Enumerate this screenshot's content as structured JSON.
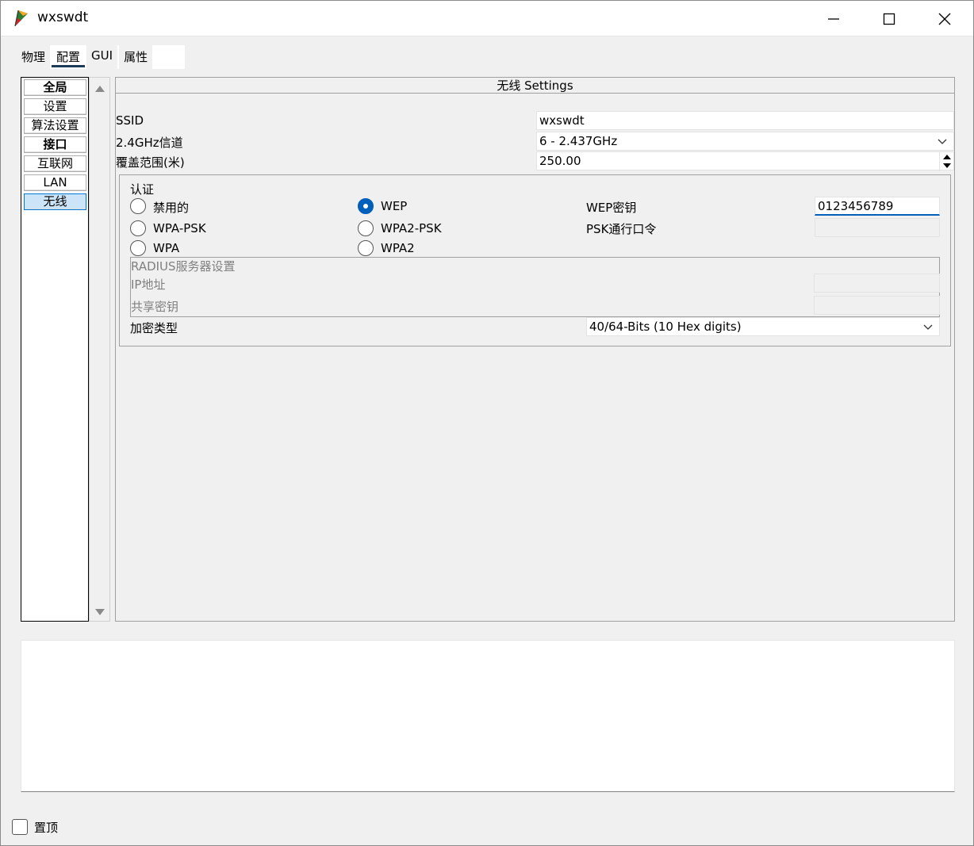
{
  "window": {
    "title": "wxswdt"
  },
  "tabs": [
    {
      "label": "物理"
    },
    {
      "label": "配置"
    },
    {
      "label": "GUI"
    },
    {
      "label": "属性"
    }
  ],
  "nav": {
    "items": [
      {
        "label": "全局"
      },
      {
        "label": "设置"
      },
      {
        "label": "算法设置"
      },
      {
        "label": "接口"
      },
      {
        "label": "互联网"
      },
      {
        "label": "LAN"
      },
      {
        "label": "无线"
      }
    ]
  },
  "panel": {
    "title": "无线 Settings",
    "ssid_label": "SSID",
    "ssid_value": "wxswdt",
    "channel_label": "2.4GHz信道",
    "channel_value": "6 - 2.437GHz",
    "range_label": "覆盖范围(米)",
    "range_value": "250.00",
    "auth": {
      "title": "认证",
      "options": [
        {
          "label": "禁用的",
          "checked": false
        },
        {
          "label": "WEP",
          "checked": true
        },
        {
          "label": "WPA-PSK",
          "checked": false
        },
        {
          "label": "WPA2-PSK",
          "checked": false
        },
        {
          "label": "WPA",
          "checked": false
        },
        {
          "label": "WPA2",
          "checked": false
        }
      ],
      "wep_key_label": "WEP密钥",
      "wep_key_value": "0123456789",
      "psk_label": "PSK通行口令",
      "radius_title": "RADIUS服务器设置",
      "ip_label": "IP地址",
      "secret_label": "共享密钥",
      "encrypt_label": "加密类型",
      "encrypt_value": "40/64-Bits (10 Hex digits)"
    }
  },
  "footer": {
    "pin_label": "置顶"
  }
}
